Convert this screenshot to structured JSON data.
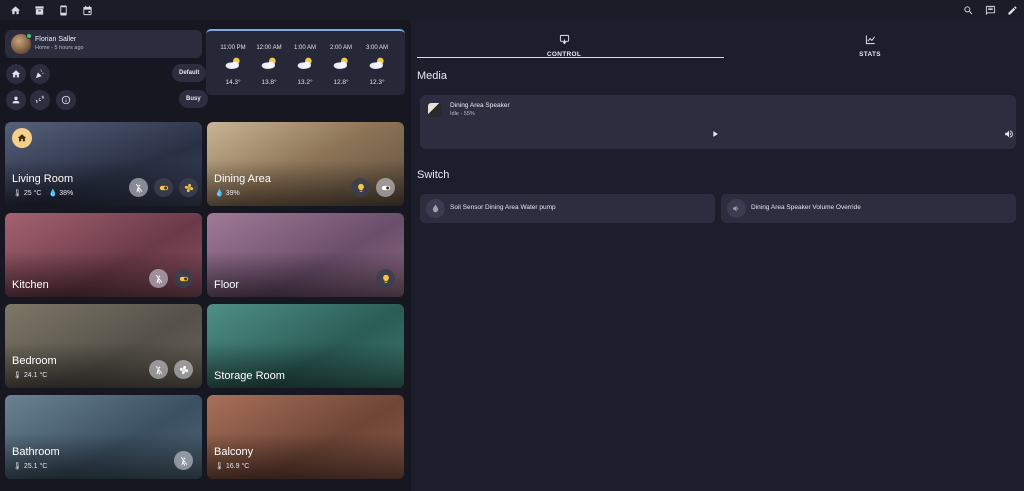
{
  "topbar": {
    "icons": [
      "home-icon",
      "archive-box-icon",
      "phone-icon",
      "calendar-icon"
    ],
    "right_icons": [
      "search-icon",
      "chat-icon",
      "edit-pencil-icon"
    ]
  },
  "profile": {
    "name": "Florian Saller",
    "status": "Home - 5 hours ago"
  },
  "modes": {
    "default_label": "Default",
    "busy_label": "Busy"
  },
  "weather": [
    {
      "time": "11:00 PM",
      "temp": "14.3°",
      "icon": "partly-cloudy-night-icon"
    },
    {
      "time": "12:00 AM",
      "temp": "13.8°",
      "icon": "partly-cloudy-night-icon"
    },
    {
      "time": "1:00 AM",
      "temp": "13.2°",
      "icon": "partly-cloudy-night-icon"
    },
    {
      "time": "2:00 AM",
      "temp": "12.8°",
      "icon": "partly-cloudy-night-icon"
    },
    {
      "time": "3:00 AM",
      "temp": "12.3°",
      "icon": "partly-cloudy-night-icon"
    }
  ],
  "rooms": [
    {
      "name": "Living Room",
      "sub1": "25 °C",
      "sub2": "38%",
      "color": "#3b4158"
    },
    {
      "name": "Dining Area",
      "sub1": "39%",
      "color": "#a58d6e"
    },
    {
      "name": "Kitchen",
      "color": "#8b5560"
    },
    {
      "name": "Floor",
      "color": "#8c6a82"
    },
    {
      "name": "Bedroom",
      "sub1": "24.1 °C",
      "color": "#6a6558"
    },
    {
      "name": "Storage Room",
      "color": "#3e7a72"
    },
    {
      "name": "Bathroom",
      "sub1": "25.1 °C",
      "color": "#4e6575"
    },
    {
      "name": "Balcony",
      "sub1": "16.9 °C",
      "color": "#8a5a4a"
    }
  ],
  "tabs": {
    "control": "CONTROL",
    "stats": "STATS"
  },
  "sections": {
    "media": "Media",
    "switch": "Switch"
  },
  "media": {
    "title": "Dining Area Speaker",
    "state": "Idle - 55%"
  },
  "switches": [
    {
      "label": "Soil Sensor Dining Area Water pump",
      "icon": "water-drop-icon"
    },
    {
      "label": "Dining Area Speaker Volume Override",
      "icon": "volume-icon"
    }
  ],
  "colors": {
    "accent_yellow": "#f5c542",
    "background": "#1c1c28",
    "card": "#2c2e40"
  }
}
